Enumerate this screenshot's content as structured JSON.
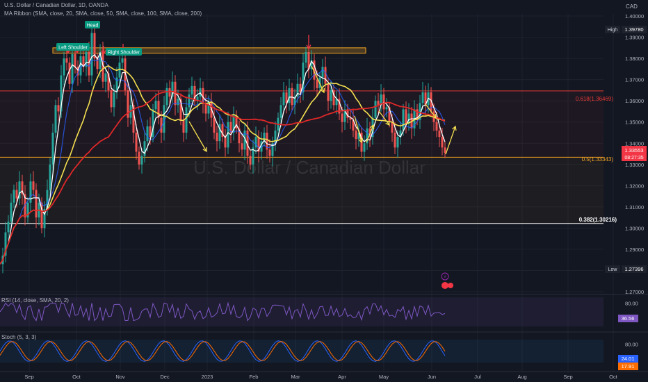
{
  "header": {
    "symbol_line": "U.S. Dollar / Canadian Dollar, 1D, OANDA",
    "ribbon_line": "MA Ribbon (SMA, close, 20, SMA, close, 50, SMA, close, 100, SMA, close, 200)",
    "currency": "CAD",
    "watermark": "U.S. Dollar / Canadian Dollar"
  },
  "colors": {
    "background": "#131722",
    "up": "#26a69a",
    "down": "#ef5350",
    "sma20": "#ffffff",
    "sma50": "#2962ff",
    "sma100": "#f5e050",
    "sma200": "#e02828",
    "fib_0618": "#e53935",
    "fib_05": "#f5a623",
    "fib_0382": "#ffffff",
    "annotation_arrow": "#f5e050",
    "signal_arrow": "#f23645"
  },
  "chart_data": {
    "type": "candlestick",
    "symbol": "USDCAD",
    "timeframe": "1D",
    "y_range": [
      1.27,
      1.401
    ],
    "price_ticks": [
      1.4,
      1.39,
      1.38,
      1.37,
      1.36,
      1.35,
      1.34,
      1.33,
      1.32,
      1.31,
      1.3,
      1.29,
      1.28,
      1.27
    ],
    "x_labels": [
      "Sep",
      "Oct",
      "Nov",
      "Dec",
      "2023",
      "Feb",
      "Mar",
      "Apr",
      "May",
      "Jun",
      "Jul",
      "Aug",
      "Sep",
      "Oct"
    ],
    "last_price": "1.33553",
    "countdown": "08:27:35",
    "high": {
      "label": "High",
      "value": "1.39780"
    },
    "low": {
      "label": "Low",
      "value": "1.27396"
    },
    "fib_levels": [
      {
        "label": "0.618(1.36469)",
        "value": 1.36469
      },
      {
        "label": "0.5(1.33343)",
        "value": 1.33343
      },
      {
        "label": "0.382(1.30216)",
        "value": 1.30216
      }
    ],
    "pattern_labels": [
      "Left Shoulder",
      "Head",
      "Right Shoulder"
    ],
    "resistance_zone": [
      1.3825,
      1.385
    ],
    "price_path": [
      [
        0,
        1.283
      ],
      [
        4,
        1.287
      ],
      [
        8,
        1.298
      ],
      [
        12,
        1.303
      ],
      [
        16,
        1.312
      ],
      [
        20,
        1.318
      ],
      [
        24,
        1.314
      ],
      [
        28,
        1.322
      ],
      [
        32,
        1.316
      ],
      [
        36,
        1.305
      ],
      [
        40,
        1.312
      ],
      [
        44,
        1.322
      ],
      [
        48,
        1.318
      ],
      [
        52,
        1.305
      ],
      [
        56,
        1.312
      ],
      [
        60,
        1.3
      ],
      [
        64,
        1.309
      ],
      [
        68,
        1.318
      ],
      [
        72,
        1.33
      ],
      [
        76,
        1.345
      ],
      [
        80,
        1.358
      ],
      [
        84,
        1.355
      ],
      [
        88,
        1.372
      ],
      [
        92,
        1.38
      ],
      [
        96,
        1.378
      ],
      [
        100,
        1.368
      ],
      [
        104,
        1.382
      ],
      [
        108,
        1.376
      ],
      [
        112,
        1.372
      ],
      [
        116,
        1.381
      ],
      [
        120,
        1.376
      ],
      [
        124,
        1.383
      ],
      [
        128,
        1.372
      ],
      [
        132,
        1.392
      ],
      [
        136,
        1.38
      ],
      [
        140,
        1.375
      ],
      [
        144,
        1.383
      ],
      [
        148,
        1.369
      ],
      [
        152,
        1.373
      ],
      [
        156,
        1.365
      ],
      [
        160,
        1.357
      ],
      [
        164,
        1.364
      ],
      [
        168,
        1.371
      ],
      [
        172,
        1.378
      ],
      [
        176,
        1.38
      ],
      [
        180,
        1.365
      ],
      [
        184,
        1.352
      ],
      [
        188,
        1.358
      ],
      [
        192,
        1.345
      ],
      [
        196,
        1.336
      ],
      [
        200,
        1.33
      ],
      [
        204,
        1.334
      ],
      [
        208,
        1.341
      ],
      [
        212,
        1.348
      ],
      [
        216,
        1.343
      ],
      [
        220,
        1.356
      ],
      [
        224,
        1.36
      ],
      [
        228,
        1.352
      ],
      [
        232,
        1.345
      ],
      [
        236,
        1.358
      ],
      [
        240,
        1.366
      ],
      [
        244,
        1.362
      ],
      [
        248,
        1.369
      ],
      [
        252,
        1.358
      ],
      [
        256,
        1.361
      ],
      [
        260,
        1.351
      ],
      [
        264,
        1.345
      ],
      [
        268,
        1.357
      ],
      [
        272,
        1.363
      ],
      [
        276,
        1.367
      ],
      [
        280,
        1.36
      ],
      [
        284,
        1.362
      ],
      [
        288,
        1.366
      ],
      [
        292,
        1.359
      ],
      [
        296,
        1.354
      ],
      [
        300,
        1.36
      ],
      [
        304,
        1.352
      ],
      [
        308,
        1.345
      ],
      [
        312,
        1.341
      ],
      [
        316,
        1.349
      ],
      [
        320,
        1.343
      ],
      [
        324,
        1.338
      ],
      [
        328,
        1.35
      ],
      [
        332,
        1.345
      ],
      [
        336,
        1.353
      ],
      [
        340,
        1.347
      ],
      [
        344,
        1.34
      ],
      [
        348,
        1.337
      ],
      [
        352,
        1.346
      ],
      [
        356,
        1.334
      ],
      [
        360,
        1.33
      ],
      [
        364,
        1.338
      ],
      [
        368,
        1.343
      ],
      [
        372,
        1.336
      ],
      [
        376,
        1.341
      ],
      [
        380,
        1.345
      ],
      [
        384,
        1.337
      ],
      [
        388,
        1.334
      ],
      [
        392,
        1.34
      ],
      [
        396,
        1.346
      ],
      [
        400,
        1.352
      ],
      [
        404,
        1.358
      ],
      [
        408,
        1.364
      ],
      [
        412,
        1.359
      ],
      [
        416,
        1.366
      ],
      [
        420,
        1.358
      ],
      [
        424,
        1.362
      ],
      [
        428,
        1.368
      ],
      [
        432,
        1.364
      ],
      [
        436,
        1.378
      ],
      [
        440,
        1.383
      ],
      [
        444,
        1.375
      ],
      [
        448,
        1.379
      ],
      [
        452,
        1.37
      ],
      [
        456,
        1.366
      ],
      [
        460,
        1.371
      ],
      [
        464,
        1.376
      ],
      [
        468,
        1.368
      ],
      [
        472,
        1.36
      ],
      [
        476,
        1.365
      ],
      [
        480,
        1.358
      ],
      [
        484,
        1.361
      ],
      [
        488,
        1.354
      ],
      [
        492,
        1.35
      ],
      [
        496,
        1.356
      ],
      [
        500,
        1.352
      ],
      [
        504,
        1.351
      ],
      [
        508,
        1.346
      ],
      [
        512,
        1.342
      ],
      [
        516,
        1.345
      ],
      [
        520,
        1.336
      ],
      [
        524,
        1.34
      ],
      [
        528,
        1.347
      ],
      [
        532,
        1.343
      ],
      [
        536,
        1.352
      ],
      [
        540,
        1.36
      ],
      [
        544,
        1.358
      ],
      [
        548,
        1.363
      ],
      [
        552,
        1.356
      ],
      [
        556,
        1.357
      ],
      [
        560,
        1.35
      ],
      [
        564,
        1.345
      ],
      [
        568,
        1.338
      ],
      [
        572,
        1.343
      ],
      [
        576,
        1.346
      ],
      [
        580,
        1.356
      ],
      [
        584,
        1.349
      ],
      [
        588,
        1.354
      ],
      [
        592,
        1.347
      ],
      [
        596,
        1.356
      ],
      [
        600,
        1.351
      ],
      [
        604,
        1.359
      ],
      [
        608,
        1.364
      ],
      [
        612,
        1.358
      ],
      [
        616,
        1.364
      ],
      [
        620,
        1.355
      ],
      [
        624,
        1.35
      ],
      [
        628,
        1.346
      ],
      [
        632,
        1.343
      ],
      [
        636,
        1.338
      ],
      [
        640,
        1.3355
      ]
    ],
    "indicators": [
      {
        "name": "RSI (14, close, SMA, 20, 2)",
        "value": "36.56",
        "levels": [
          80.0
        ]
      },
      {
        "name": "Stoch (5, 3, 3)",
        "value_k": "24.01",
        "value_d": "17.91",
        "levels": [
          80.0
        ]
      }
    ]
  }
}
